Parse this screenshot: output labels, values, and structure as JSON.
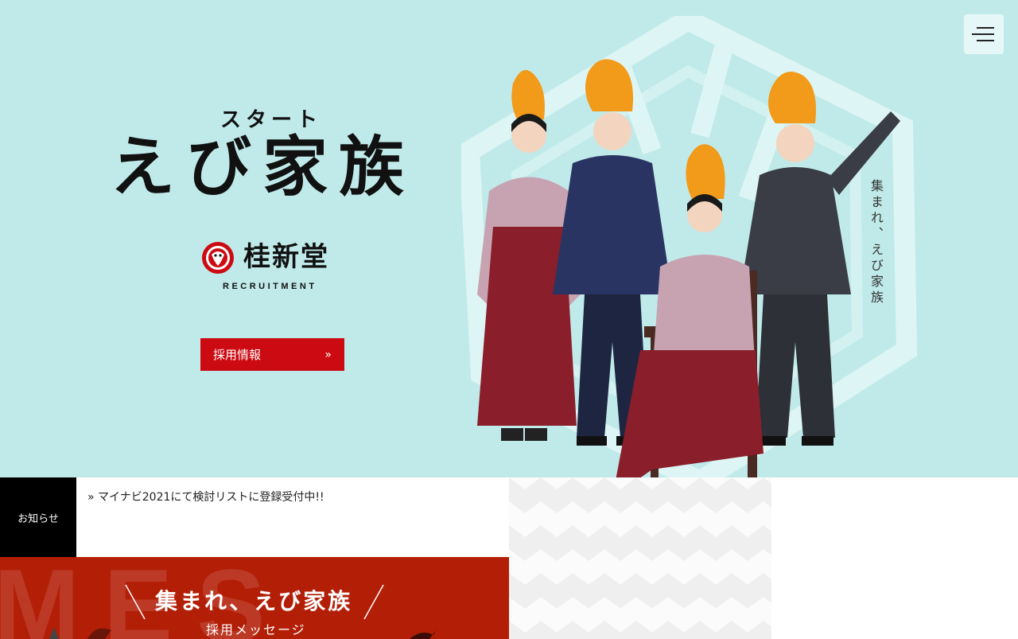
{
  "header": {
    "menu_icon": "hamburger-menu-icon"
  },
  "hero": {
    "kicker": "スタート",
    "title": "えび家族",
    "brand_name": "桂新堂",
    "brand_sub": "RECRUITMENT",
    "recruit_button_label": "採用情報",
    "recruit_button_chevron": "»",
    "vertical_copy": "集まれ、えび家族",
    "colors": {
      "background": "#c0eaea",
      "accent": "#cc0a12"
    }
  },
  "news": {
    "label": "お知らせ",
    "items": [
      {
        "prefix": "»",
        "text": "マイナビ2021にて検討リストに登録受付中!!"
      }
    ]
  },
  "message": {
    "ghost_text": "MES",
    "title": "集まれ、えび家族",
    "subtitle": "採用メッセージ",
    "colors": {
      "background": "#b31e07"
    }
  }
}
